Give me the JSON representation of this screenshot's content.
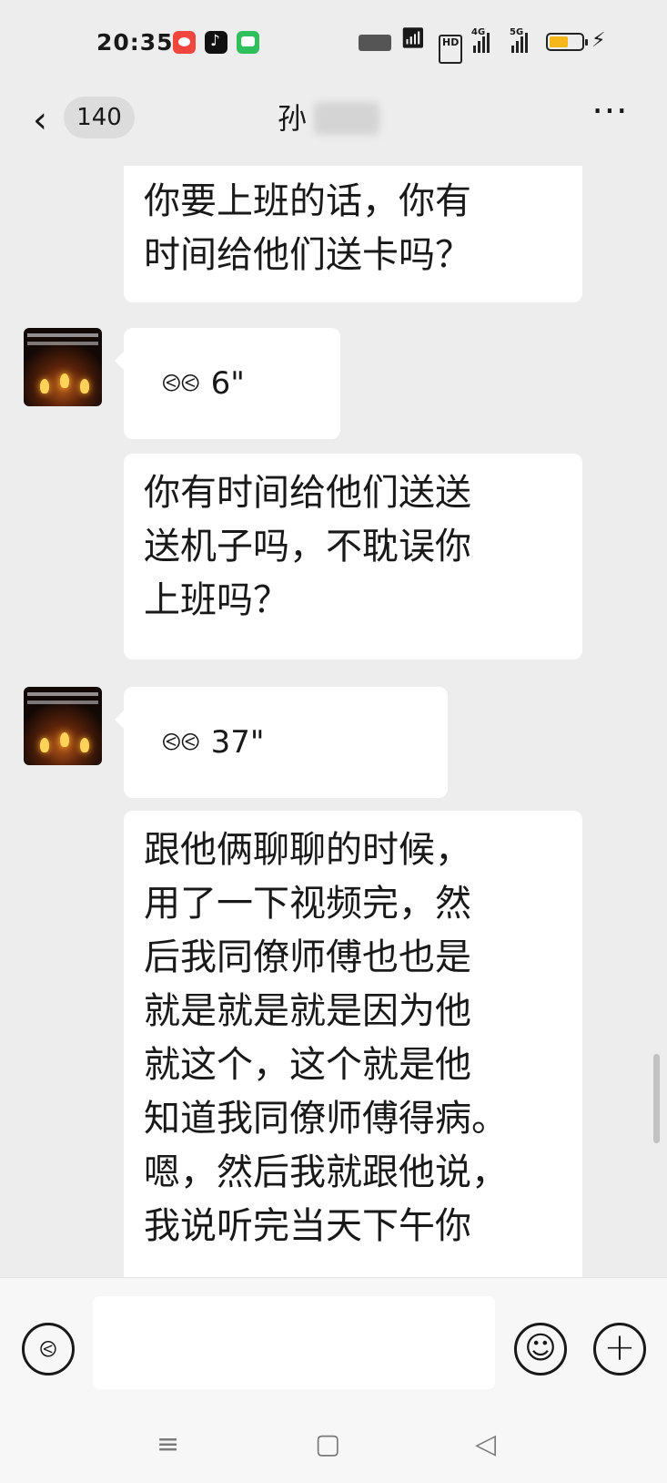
{
  "status_bar": {
    "time": "20:35",
    "hd_label": "HD",
    "net1": "4G",
    "net2": "5G"
  },
  "header": {
    "unread_count": "140",
    "contact_name": "孙"
  },
  "messages": [
    {
      "kind": "text",
      "text": "你要上班的话，你有\n时间给他们送卡吗？"
    },
    {
      "kind": "voice",
      "duration": "6\""
    },
    {
      "kind": "text",
      "text": "你有时间给他们送送\n送机子吗，不耽误你\n上班吗？"
    },
    {
      "kind": "voice",
      "duration": "37\""
    },
    {
      "kind": "text",
      "text": "跟他俩聊聊的时候，\n用了一下视频完，然\n后我同僚师傅也也是\n就是就是就是因为他\n就这个，这个就是他\n知道我同僚师傅得病。\n嗯，然后我就跟他说，\n我说听完当天下午你"
    }
  ],
  "icons": {
    "back": "chevron-left-icon",
    "more": "more-icon",
    "voice_input": "voice-input-icon",
    "emoji": "emoji-icon",
    "plus": "plus-icon"
  },
  "colors": {
    "background": "#ededed",
    "bubble": "#ffffff",
    "battery_fill": "#f5b71a"
  }
}
